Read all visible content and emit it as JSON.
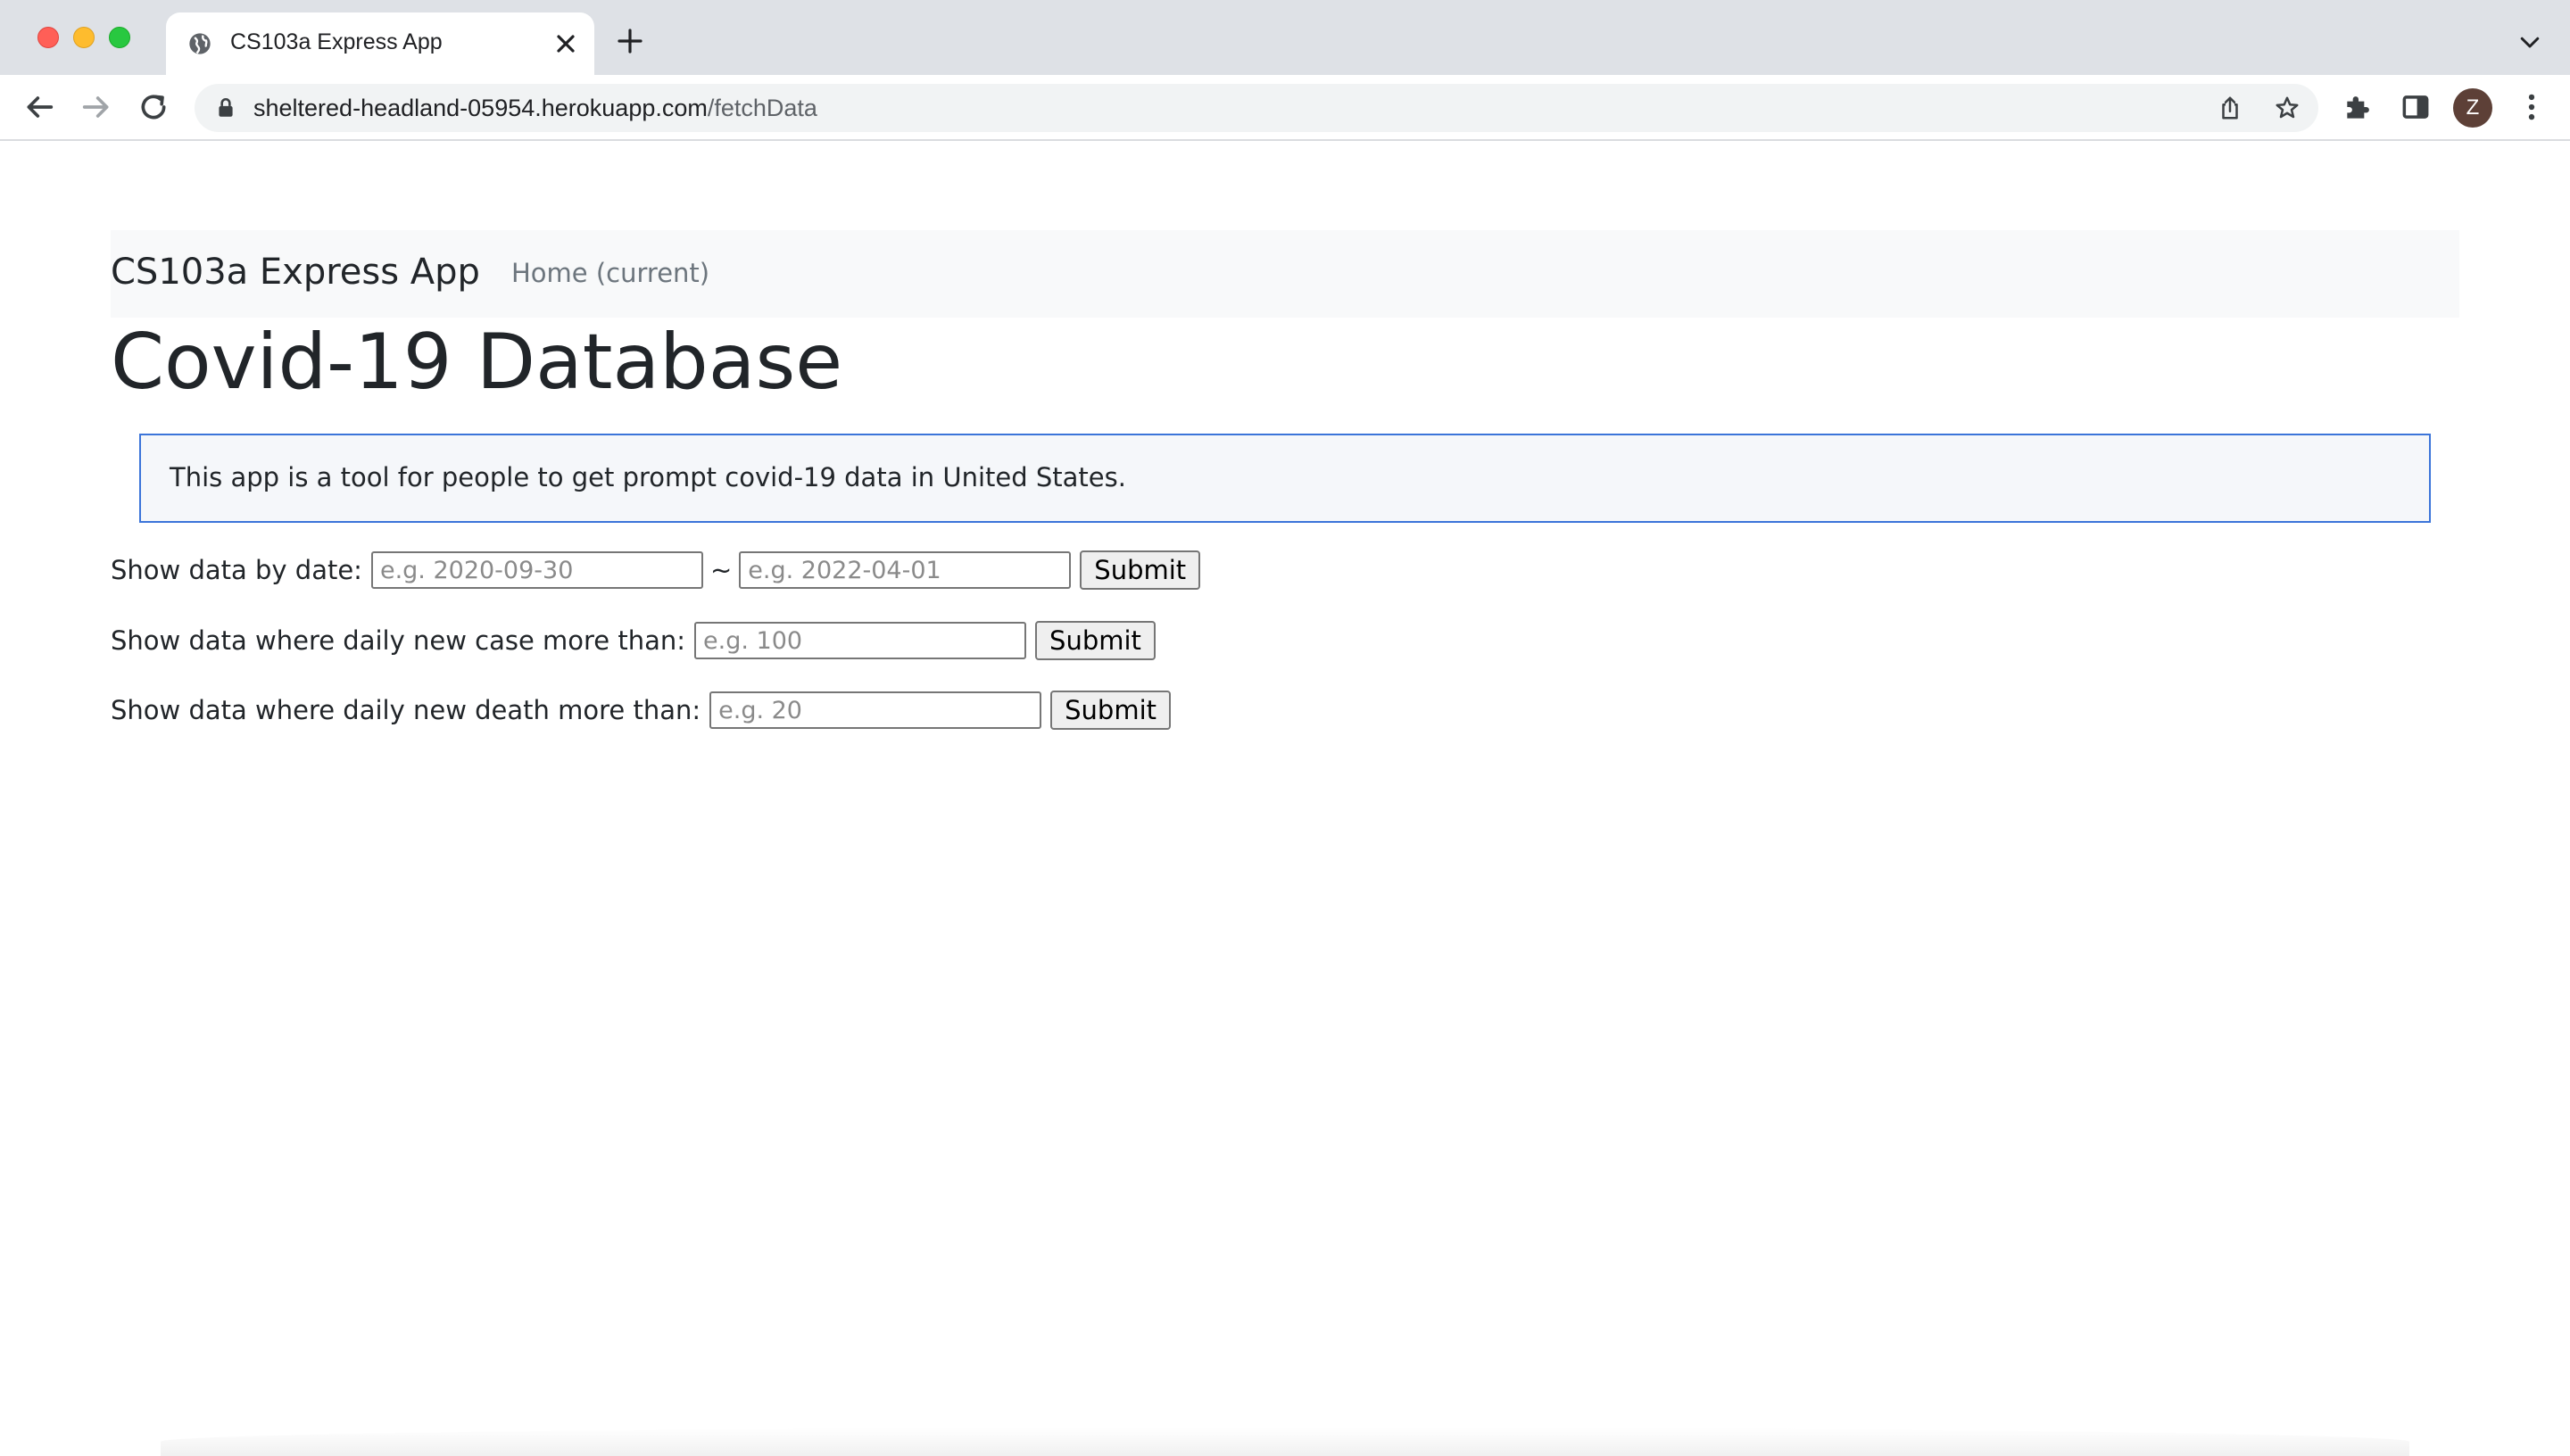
{
  "browser": {
    "tab": {
      "title": "CS103a Express App",
      "favicon": "globe-icon"
    },
    "address_bar": {
      "domain": "sheltered-headland-05954.herokuapp.com",
      "path": "/fetchData"
    },
    "profile_initial": "Z"
  },
  "navbar": {
    "brand": "CS103a Express App",
    "links": [
      {
        "label": "Home (current)"
      }
    ]
  },
  "page": {
    "title": "Covid-19 Database",
    "info": "This app is a tool for people to get prompt covid-19 data in United States."
  },
  "forms": {
    "by_date": {
      "label": "Show data by date:",
      "start_placeholder": "e.g. 2020-09-30",
      "separator": "~",
      "end_placeholder": "e.g. 2022-04-01",
      "submit": "Submit"
    },
    "by_cases": {
      "label": "Show data where daily new case more than:",
      "placeholder": "e.g. 100",
      "submit": "Submit"
    },
    "by_deaths": {
      "label": "Show data where daily new death more than:",
      "placeholder": "e.g. 20",
      "submit": "Submit"
    }
  },
  "colors": {
    "info_border": "#3b74d9",
    "navbar_bg": "#f8f9fa",
    "avatar_bg": "#5d4037"
  }
}
